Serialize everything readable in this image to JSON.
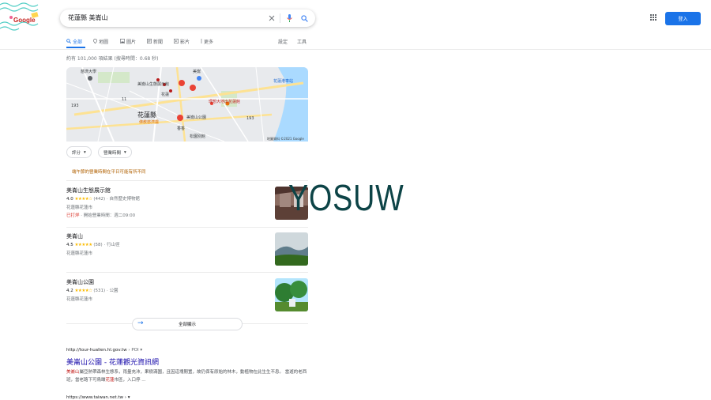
{
  "logo": {
    "text": "Google"
  },
  "search": {
    "query": "花蓮縣 美崙山"
  },
  "header": {
    "login_label": "登入"
  },
  "tabs": [
    {
      "label": "全部",
      "icon": "search-icon",
      "active": true
    },
    {
      "label": "地圖",
      "icon": "map-pin-icon"
    },
    {
      "label": "圖片",
      "icon": "image-icon"
    },
    {
      "label": "新聞",
      "icon": "news-icon"
    },
    {
      "label": "影片",
      "icon": "video-icon"
    },
    {
      "label": "更多",
      "icon": "more-vert-icon"
    }
  ],
  "tools": {
    "settings": "設定",
    "tools": "工具"
  },
  "result_stats": "約有 101,000 項結果 (搜尋時間：0.68 秒)",
  "map": {
    "labels": {
      "campus": "慈濟大學",
      "museum": "美崙山生態展示館",
      "meilun": "美崙",
      "station": "花蓮港車站",
      "hotel": "理想大地出花蓮館",
      "hualien": "花蓮",
      "county": "花蓮縣",
      "park": "美崙山公園",
      "temple": "佛教慈濟醫",
      "temple2": "香香",
      "square": "松園別館",
      "road": "193",
      "road2": "193",
      "road3": "11",
      "copyright": "地圖資料 ©2021 Google"
    }
  },
  "filters": {
    "rating": "評分",
    "hours": "營業時間"
  },
  "notice": "端午節的營業時間在平日可能有所不同",
  "places": [
    {
      "name": "美崙山生態展示館",
      "rating": "4.0",
      "stars": "★★★★☆",
      "reviews": "(442)",
      "category": "自然歷史博物館",
      "address": "花蓮縣花蓮市",
      "status": "已打烊",
      "hours": "開始營業時間：週二09:00"
    },
    {
      "name": "美崙山",
      "rating": "4.5",
      "stars": "★★★★★",
      "reviews": "(58)",
      "category": "行山徑",
      "address": "花蓮縣花蓮市"
    },
    {
      "name": "美崙山公園",
      "rating": "4.2",
      "stars": "★★★★☆",
      "reviews": "(531)",
      "category": "公園",
      "address": "花蓮縣花蓮市"
    }
  ],
  "more_places": "全部顯示",
  "watermark": "YOSUW",
  "results": [
    {
      "url": "http://tour-hualien.hl.gov.tw",
      "crumb": " › POI",
      "title": "美崙山公園 - 花蓮觀光資訊網",
      "snippet_hl": "美崙山",
      "snippet1": "屬亞熱帶森林生態系，雨量充沛，果樹滿園，且因這塊閒置，故仍保有原始的林木，動植物在此生生不息。 當遊的老西班，當老路下可鳥瞰",
      "snippet_hl2": "花蓮",
      "snippet2": "市區，入口停 ..."
    },
    {
      "url": "https://www.taiwan.net.tw",
      "crumb": " › "
    }
  ],
  "colors": {
    "accent": "#1a73e8",
    "link": "#1a0dab",
    "star": "#fbbc04",
    "closed": "#d93025"
  }
}
